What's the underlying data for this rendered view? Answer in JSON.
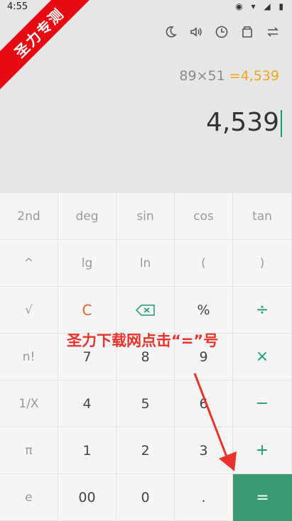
{
  "status": {
    "time": "4:55",
    "icons": "◉ ▾ ◢ ▮"
  },
  "toolbar": {
    "items": [
      {
        "name": "theme-night-icon",
        "glyph": "☾"
      },
      {
        "name": "sound-icon",
        "glyph": "🔈"
      },
      {
        "name": "history-icon",
        "glyph": "◷"
      },
      {
        "name": "memory-icon",
        "glyph": "▣"
      },
      {
        "name": "switch-icon",
        "glyph": "⇄"
      }
    ]
  },
  "display": {
    "expression": "89×51",
    "preview": "=4,539",
    "result": "4,539"
  },
  "keys": [
    [
      {
        "label": "2nd",
        "type": "sci"
      },
      {
        "label": "deg",
        "type": "sci"
      },
      {
        "label": "sin",
        "type": "sci"
      },
      {
        "label": "cos",
        "type": "sci"
      },
      {
        "label": "tan",
        "type": "sci"
      }
    ],
    [
      {
        "label": "^",
        "type": "sci"
      },
      {
        "label": "lg",
        "type": "sci"
      },
      {
        "label": "ln",
        "type": "sci"
      },
      {
        "label": "(",
        "type": "sci"
      },
      {
        "label": ")",
        "type": "sci"
      }
    ],
    [
      {
        "label": "√",
        "type": "sci"
      },
      {
        "label": "C",
        "type": "clear"
      },
      {
        "label": "⌫",
        "type": "backspace"
      },
      {
        "label": "%",
        "type": "num"
      },
      {
        "label": "÷",
        "type": "op"
      }
    ],
    [
      {
        "label": "n!",
        "type": "sci"
      },
      {
        "label": "7",
        "type": "num"
      },
      {
        "label": "8",
        "type": "num"
      },
      {
        "label": "9",
        "type": "num"
      },
      {
        "label": "×",
        "type": "op"
      }
    ],
    [
      {
        "label": "1/X",
        "type": "sci"
      },
      {
        "label": "4",
        "type": "num"
      },
      {
        "label": "5",
        "type": "num"
      },
      {
        "label": "6",
        "type": "num"
      },
      {
        "label": "−",
        "type": "op"
      }
    ],
    [
      {
        "label": "π",
        "type": "sci"
      },
      {
        "label": "1",
        "type": "num"
      },
      {
        "label": "2",
        "type": "num"
      },
      {
        "label": "3",
        "type": "num"
      },
      {
        "label": "+",
        "type": "op"
      }
    ],
    [
      {
        "label": "e",
        "type": "sci"
      },
      {
        "label": "00",
        "type": "num"
      },
      {
        "label": "0",
        "type": "num"
      },
      {
        "label": ".",
        "type": "num"
      },
      {
        "label": "=",
        "type": "equals"
      }
    ]
  ],
  "overlay": {
    "banner": "圣力专测",
    "caption": "圣力下载网点击“=”号"
  },
  "colors": {
    "accent": "#1b9a78",
    "equals_bg": "#3b9a74",
    "clear": "#e4632b",
    "preview": "#f2a31c",
    "banner": "#e60b12"
  }
}
